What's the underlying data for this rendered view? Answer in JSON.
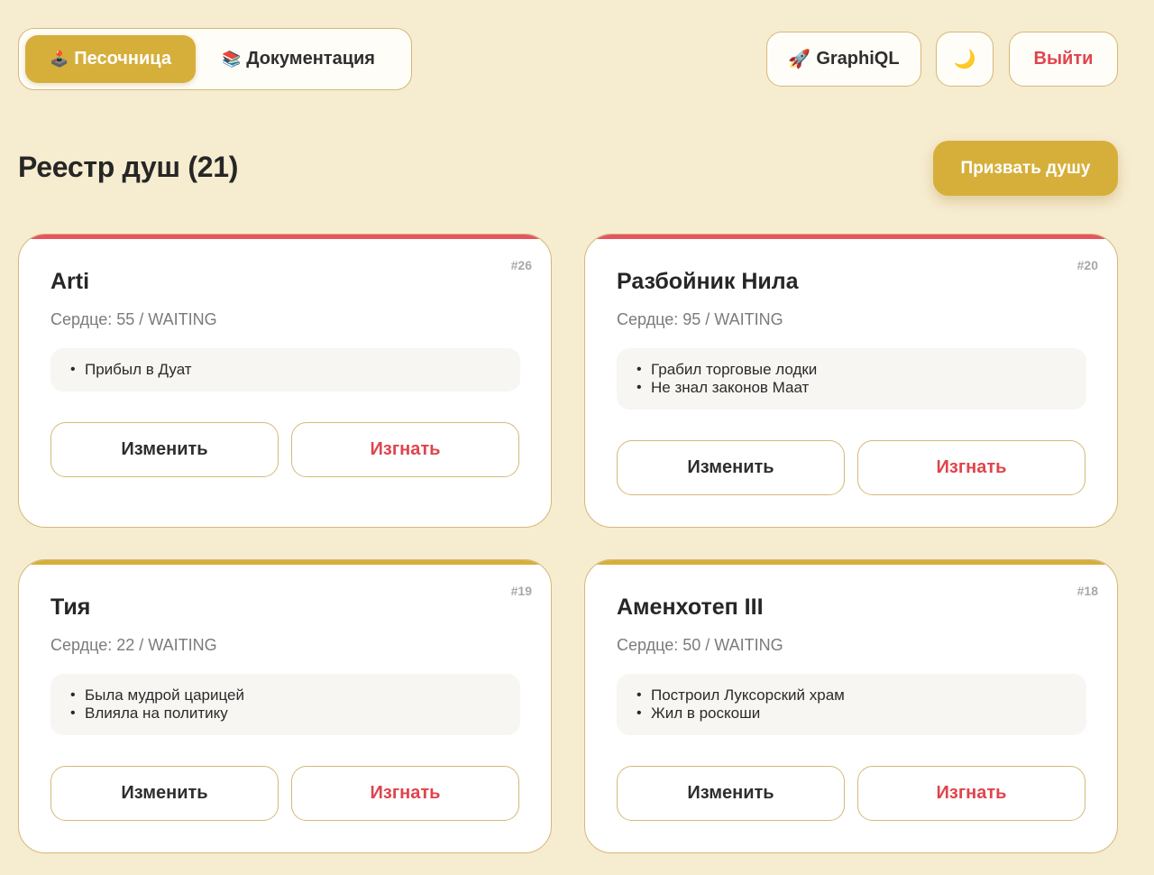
{
  "nav": {
    "tab_sandbox": {
      "glyph": "🕹️",
      "label": "Песочница"
    },
    "tab_docs": {
      "glyph": "📚",
      "label": "Документация"
    },
    "graphiql": {
      "glyph": "🚀",
      "label": "GraphiQL"
    },
    "theme_glyph": "🌙",
    "logout_label": "Выйти"
  },
  "header": {
    "title": "Реестр душ (21)",
    "summon_label": "Призвать душу"
  },
  "cards": [
    {
      "id": "#26",
      "name": "Arti",
      "heart": "Сердце: 55 / WAITING",
      "notes": [
        "Прибыл в Дуат"
      ],
      "accent": "#e55560",
      "edit_label": "Изменить",
      "banish_label": "Изгнать"
    },
    {
      "id": "#20",
      "name": "Разбойник Нила",
      "heart": "Сердце: 95 / WAITING",
      "notes": [
        "Грабил торговые лодки",
        "Не знал законов Маат"
      ],
      "accent": "#e55560",
      "edit_label": "Изменить",
      "banish_label": "Изгнать"
    },
    {
      "id": "#19",
      "name": "Тия",
      "heart": "Сердце: 22 / WAITING",
      "notes": [
        "Была мудрой царицей",
        "Влияла на политику"
      ],
      "accent": "#d6af3b",
      "edit_label": "Изменить",
      "banish_label": "Изгнать"
    },
    {
      "id": "#18",
      "name": "Аменхотеп III",
      "heart": "Сердце: 50 / WAITING",
      "notes": [
        "Построил Луксорский храм",
        "Жил в роскоши"
      ],
      "accent": "#d6af3b",
      "edit_label": "Изменить",
      "banish_label": "Изгнать"
    }
  ]
}
